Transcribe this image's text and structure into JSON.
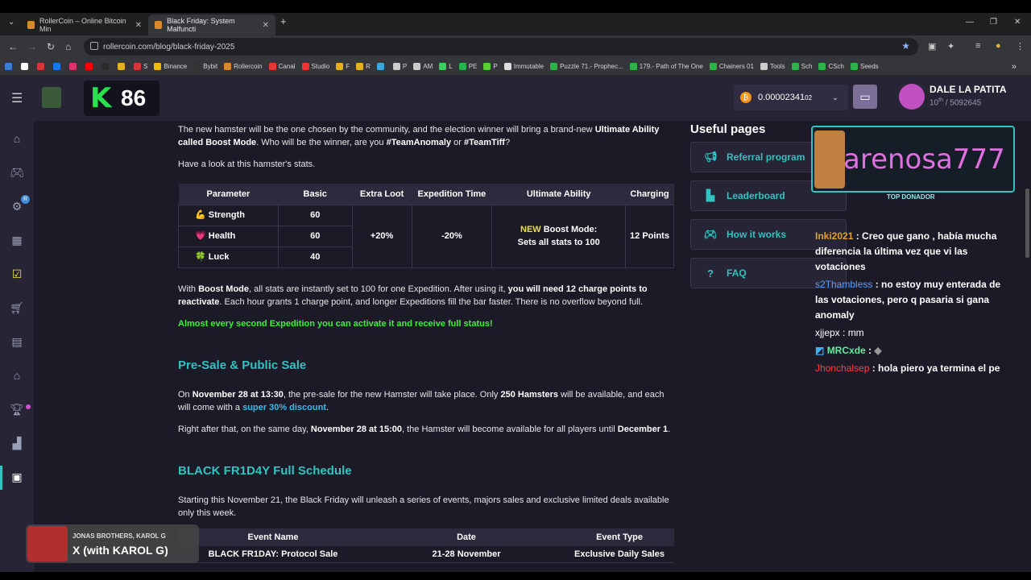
{
  "browser": {
    "tabs": [
      {
        "title": "RollerCoin – Online Bitcoin Min"
      },
      {
        "title": "Black Friday: System Malfuncti"
      }
    ],
    "url": "rollercoin.com/blog/black-friday-2025",
    "bookmarks": [
      "",
      "",
      "",
      "",
      "",
      "",
      "",
      "",
      "S",
      "Binance",
      "Bybit",
      "Rollercoin",
      "Canal",
      "Studio",
      "F",
      "R",
      "",
      "P",
      "AM",
      "L",
      "PE",
      "P",
      "Immutable",
      "Puzzle 71.- Prophec...",
      "179.- Path of The One",
      "Chainers 01",
      "Tools",
      "Sch",
      "CSch",
      "Seeds"
    ]
  },
  "header": {
    "level": "86",
    "balance": "0.00002341",
    "balance_small": "02",
    "user_name": "DALE LA PATITA",
    "rank": "10",
    "rank_suffix": "th",
    "rank_total": "/ 5092645"
  },
  "sidebar": {
    "badge": "R"
  },
  "article": {
    "intro_1": "The new hamster will be the one chosen by the community, and the election winner will bring a brand-new ",
    "intro_bold_1": "Ultimate Ability called Boost Mode",
    "intro_2": ". Who will be the winner, are you ",
    "team1": "#TeamAnomaly",
    "or": " or ",
    "team2": "#TeamTiff",
    "q": "?",
    "stats_intro": "Have a look at this hamster's stats.",
    "table_headers": [
      "Parameter",
      "Basic",
      "Extra Loot",
      "Expedition Time",
      "Ultimate Ability",
      "Charging"
    ],
    "params": [
      {
        "icon": "💪",
        "name": "Strength",
        "basic": "60"
      },
      {
        "icon": "💗",
        "name": "Health",
        "basic": "60"
      },
      {
        "icon": "🍀",
        "name": "Luck",
        "basic": "40"
      }
    ],
    "extra_loot": "+20%",
    "expedition_time": "-20%",
    "ability_new": "NEW",
    "ability_line1": " Boost Mode:",
    "ability_line2": "Sets all stats to 100",
    "charging": "12 Points",
    "boost_p1": "With ",
    "boost_b1": "Boost Mode",
    "boost_p2": ", all stats are instantly set to 100 for one Expedition. After using it, ",
    "boost_b2": "you will need 12 charge points to reactivate",
    "boost_p3": ". Each hour grants 1 charge point, and longer Expeditions fill the bar faster. There is no overflow beyond full.",
    "highlight": "Almost every second Expedition you can activate it and receive full status!",
    "presale_heading": "Pre-Sale & Public Sale",
    "presale_p1": "On ",
    "presale_b1": "November 28 at 13:30",
    "presale_p2": ", the pre-sale for the new Hamster will take place. Only ",
    "presale_b2": "250 Hamsters",
    "presale_p3": " will be available, and each will come with a ",
    "presale_link": "super 30% discount",
    "presale_p4": ".",
    "after_p1": "Right after that, on the same day, ",
    "after_b1": "November 28 at 15:00",
    "after_p2": ", the Hamster will become available for all players until ",
    "after_b2": "December 1",
    "after_p3": ".",
    "schedule_heading": "BLACK FR1D4Y Full Schedule",
    "schedule_intro": "Starting this November 21, the Black Friday will unleash a series of events, majors sales and exclusive limited deals available only this week.",
    "schedule_headers": [
      "Event Name",
      "Date",
      "Event Type"
    ],
    "schedule_rows": [
      {
        "name": "BLACK FR1DAY: Protocol Sale",
        "date": "21-28 November",
        "type": "Exclusive Daily Sales"
      }
    ]
  },
  "useful": {
    "title": "Useful pages",
    "links": [
      "Referral program",
      "Leaderboard",
      "How it works",
      "FAQ"
    ]
  },
  "stream_overlay": {
    "donor_name": "arenosa777",
    "donor_label": "TOP DONADOR",
    "chat": [
      {
        "user": "Inki2021",
        "color": "#e0a030",
        "msg": " : Creo que gano , había mucha diferencia la última vez que vi las votaciones"
      },
      {
        "user": "s2Thambless",
        "color": "#5aa0ff",
        "msg": " : no estoy muy enterada de las votaciones, pero q pasaria si gana anomaly"
      },
      {
        "user": "xjjepx",
        "color": "#ffffff",
        "msg": " : mm"
      },
      {
        "user": "MRCxde",
        "color": "#5ef0a0",
        "msg": " : "
      },
      {
        "user": "Jhonchalsep",
        "color": "#ff4040",
        "msg": " : hola piero ya termina el pe"
      }
    ]
  },
  "now_playing": {
    "artist": "JONAS BROTHERS, KAROL G",
    "title": "X (with KAROL G)"
  }
}
